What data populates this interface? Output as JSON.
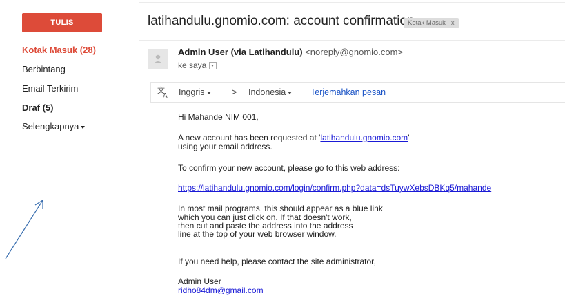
{
  "sidebar": {
    "compose_label": "TULIS",
    "items": [
      {
        "label": "Kotak Masuk (28)"
      },
      {
        "label": "Berbintang"
      },
      {
        "label": "Email Terkirim"
      },
      {
        "label": "Draf (5)"
      },
      {
        "label": "Selengkapnya"
      }
    ]
  },
  "email": {
    "subject": "latihandulu.gnomio.com: account confirmation",
    "label_chip": "Kotak Masuk",
    "label_chip_close": "x",
    "sender_name": "Admin User (via Latihandulu)",
    "sender_email": "<noreply@gnomio.com>",
    "recipient": "ke saya",
    "translate": {
      "from_lang": "Inggris",
      "arrow": ">",
      "to_lang": "Indonesia",
      "action": "Terjemahkan pesan"
    },
    "body": {
      "greeting": "Hi Mahande NIM 001,",
      "para1_before": "A new account has been requested at '",
      "para1_link": "latihandulu.gnomio.com",
      "para1_after": "'",
      "para1_line2": "using your email address.",
      "para2": "To confirm your new account, please go to this web address:",
      "confirm_link": "https://latihandulu.gnomio.com/login/confirm.php?data=dsTuywXebsDBKq5/mahande",
      "para3_lines": [
        "In most mail programs, this should appear as a blue link",
        "which you can just click on. If that doesn't work,",
        "then cut and paste the address into the address",
        "line at the top of your web browser window."
      ],
      "para4": "If you need help, please contact the site administrator,",
      "signature_name": "Admin User",
      "signature_email": "ridho84dm@gmail.com"
    }
  },
  "colors": {
    "compose_bg": "#dd4b39",
    "active_item": "#dd4b39",
    "link": "#1a1ad6",
    "translate_link": "#1a53c6",
    "annotation_arrow": "#3a6fb0"
  }
}
